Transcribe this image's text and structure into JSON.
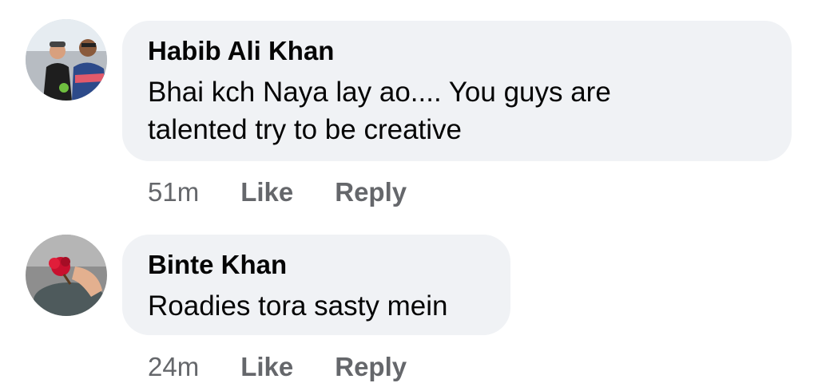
{
  "comments": [
    {
      "author": "Habib Ali Khan",
      "text": "Bhai kch Naya lay ao.... You guys are talented try to be creative",
      "time": "51m",
      "like_label": "Like",
      "reply_label": "Reply"
    },
    {
      "author": "Binte Khan",
      "text": "Roadies tora sasty mein",
      "time": "24m",
      "like_label": "Like",
      "reply_label": "Reply"
    }
  ],
  "colors": {
    "bubble": "#f0f2f5",
    "text": "#050505",
    "meta": "#65676b"
  }
}
